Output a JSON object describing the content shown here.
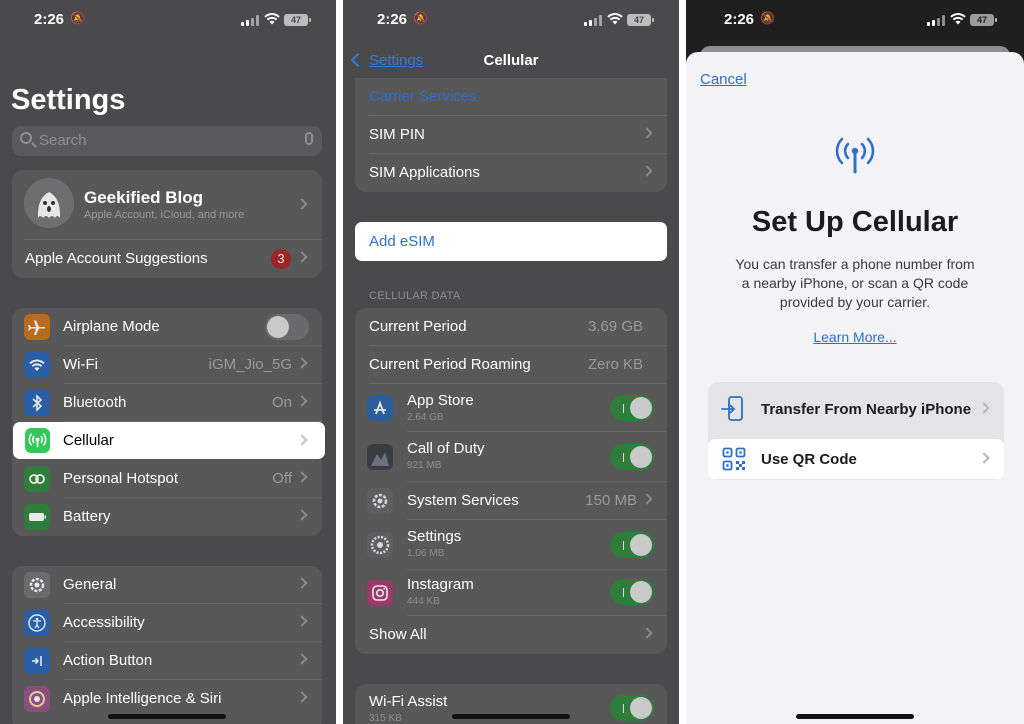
{
  "panel1": {
    "status": {
      "time": "2:26",
      "battery": "47"
    },
    "title": "Settings",
    "search": {
      "placeholder": "Search"
    },
    "account": {
      "name": "Geekified Blog",
      "subtitle": "Apple Account, iCloud, and more",
      "suggestions": "Apple Account Suggestions",
      "badge": "3"
    },
    "rows": {
      "airplane": "Airplane Mode",
      "wifi": "Wi-Fi",
      "wifi_value": "iGM_Jio_5G",
      "bluetooth": "Bluetooth",
      "bluetooth_value": "On",
      "cellular": "Cellular",
      "hotspot": "Personal Hotspot",
      "hotspot_value": "Off",
      "battery": "Battery",
      "general": "General",
      "accessibility": "Accessibility",
      "action_button": "Action Button",
      "apple_intelligence": "Apple Intelligence & Siri"
    }
  },
  "panel2": {
    "status": {
      "time": "2:26",
      "battery": "47"
    },
    "back": "Settings",
    "title": "Cellular",
    "rows": {
      "carrier_services": "Carrier Services",
      "sim_pin": "SIM PIN",
      "sim_apps": "SIM Applications",
      "add_esim": "Add eSIM"
    },
    "data_header": "CELLULAR DATA",
    "current_period": "Current Period",
    "current_period_value": "3.69 GB",
    "roaming": "Current Period Roaming",
    "roaming_value": "Zero KB",
    "apps": [
      {
        "name": "App Store",
        "size": "2.64 GB"
      },
      {
        "name": "Call of Duty",
        "size": "921 MB"
      },
      {
        "name": "System Services",
        "size": "150 MB"
      },
      {
        "name": "Settings",
        "size": "1.06 MB"
      },
      {
        "name": "Instagram",
        "size": "444 KB"
      }
    ],
    "show_all": "Show All",
    "wifi_assist": "Wi-Fi Assist",
    "wifi_assist_size": "315 KB"
  },
  "panel3": {
    "status": {
      "time": "2:26",
      "battery": "47"
    },
    "cancel": "Cancel",
    "title": "Set Up Cellular",
    "description": "You can transfer a phone number from a nearby iPhone, or scan a QR code provided by your carrier.",
    "learn_more": "Learn More...",
    "options": {
      "transfer": "Transfer From Nearby iPhone",
      "qr": "Use QR Code"
    }
  },
  "colors": {
    "accent": "#2f6fc4",
    "toggle_on": "#2f7d3a",
    "badge": "#d8262c"
  }
}
